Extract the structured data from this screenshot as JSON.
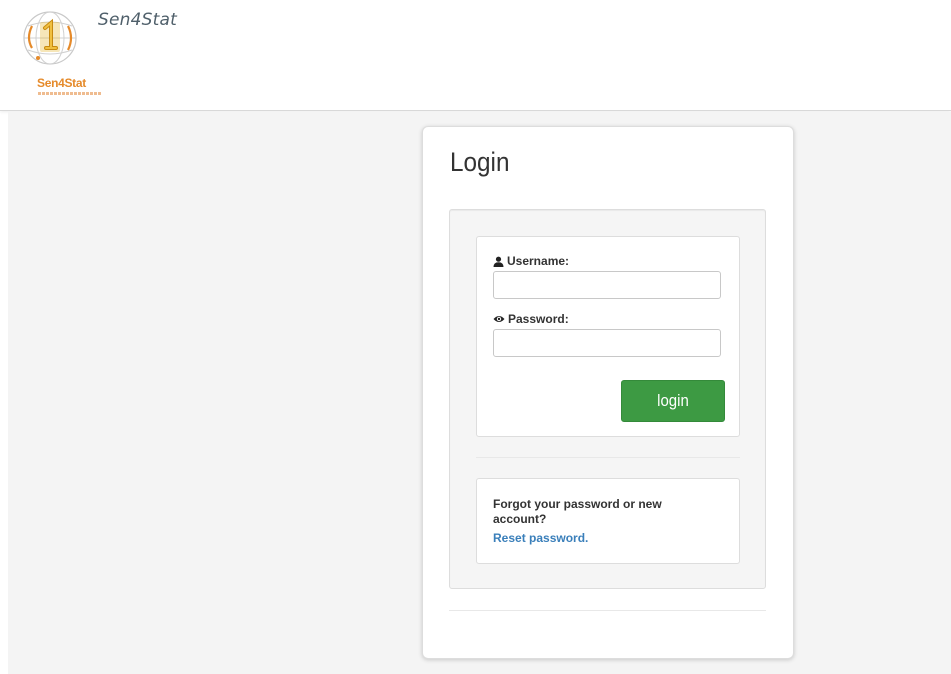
{
  "header": {
    "app_title": "Sen4Stat",
    "logo_text": "Sen4Stat",
    "logo_emblem": "globe-with-1-emblem-icon"
  },
  "login": {
    "title": "Login",
    "username_label": "Username:",
    "username_icon": "user-icon",
    "username_value": "",
    "password_label": "Password:",
    "password_icon": "eye-icon",
    "password_value": "",
    "submit_label": "login"
  },
  "help": {
    "text": "Forgot your password or new account?",
    "reset_link": "Reset password."
  },
  "colors": {
    "accent_green": "#3d9a43",
    "link_blue": "#3a7fba",
    "brand_orange": "#e58a2a"
  }
}
